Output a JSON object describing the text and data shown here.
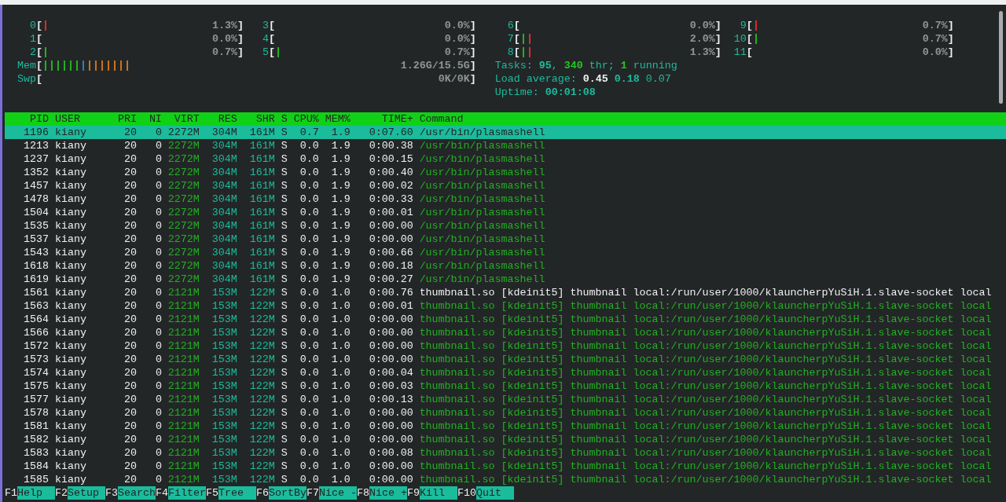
{
  "cpu_meters_left": [
    {
      "label": "0",
      "open": "[",
      "bars": [
        {
          "color": "#d32f2f"
        }
      ],
      "value": "1.3%",
      "close": "]"
    },
    {
      "label": "1",
      "open": "[",
      "value": "0.0%",
      "close": "]"
    },
    {
      "label": "2",
      "open": "[",
      "bars": [
        {
          "color": "#22b022"
        }
      ],
      "value": "0.7%",
      "close": "]"
    },
    {
      "label": "3",
      "open": "[",
      "value": "0.0%",
      "close": "]"
    },
    {
      "label": "4",
      "open": "[",
      "value": "0.0%",
      "close": "]"
    },
    {
      "label": "5",
      "open": "[",
      "bars": [
        {
          "color": "#22b022"
        }
      ],
      "value": "0.7%",
      "close": "]"
    }
  ],
  "cpu_meters_right": [
    {
      "label": "6",
      "open": "[",
      "value": "0.0%",
      "close": "]"
    },
    {
      "label": "7",
      "open": "[",
      "bars": [
        {
          "color": "#22b022"
        },
        {
          "color": "#d32f2f"
        }
      ],
      "value": "2.0%",
      "close": "]"
    },
    {
      "label": "8",
      "open": "[",
      "bars": [
        {
          "color": "#22b022"
        },
        {
          "color": "#d32f2f"
        }
      ],
      "value": "1.3%",
      "close": "]"
    },
    {
      "label": "9",
      "open": "[",
      "bars": [
        {
          "color": "#d32f2f"
        }
      ],
      "value": "0.7%",
      "close": "]"
    },
    {
      "label": "10",
      "open": "[",
      "bars": [
        {
          "color": "#22b022"
        }
      ],
      "value": "0.7%",
      "close": "]"
    },
    {
      "label": "11",
      "open": "[",
      "value": "0.0%",
      "close": "]"
    }
  ],
  "memory_meters": [
    {
      "label": "Mem",
      "open": "[",
      "bars": [
        {
          "color": "#22b022"
        },
        {
          "color": "#22b022"
        },
        {
          "color": "#22b022"
        },
        {
          "color": "#22b022"
        },
        {
          "color": "#22b022"
        },
        {
          "color": "#22b022"
        },
        {
          "color": "#2980b9"
        },
        {
          "color": "#c8741c"
        },
        {
          "color": "#c8741c"
        },
        {
          "color": "#c8741c"
        },
        {
          "color": "#c8741c"
        },
        {
          "color": "#c8741c"
        },
        {
          "color": "#c8741c"
        },
        {
          "color": "#c8741c"
        }
      ],
      "value": "1.26G/15.5G",
      "close": "]"
    },
    {
      "label": "Swp",
      "open": "[",
      "value": "0K/0K",
      "close": "]"
    }
  ],
  "summary_lines": [
    [
      {
        "text": "Tasks:",
        "kind": "label"
      },
      {
        "text": "95",
        "kind": "value"
      },
      {
        "text": ",",
        "kind": "punct"
      },
      {
        "text": "340",
        "kind": "highlight"
      },
      {
        "text": "thr;",
        "kind": "label"
      },
      {
        "text": "1",
        "kind": "highlight"
      },
      {
        "text": "running",
        "kind": "label"
      }
    ],
    [
      {
        "text": "Load average:",
        "kind": "label"
      },
      {
        "text": "0.45",
        "kind": "strong"
      },
      {
        "text": "0.18",
        "kind": "value"
      },
      {
        "text": "0.07",
        "kind": "label"
      }
    ],
    [
      {
        "text": "Uptime:",
        "kind": "label"
      },
      {
        "text": "00:01:08",
        "kind": "value"
      }
    ]
  ],
  "table": {
    "columns": [
      "PID",
      "USER",
      "PRI",
      "NI",
      "VIRT",
      "RES",
      "SHR",
      "S",
      "CPU%",
      "MEM%",
      "TIME+",
      "Command"
    ],
    "rows": [
      {
        "selected": true,
        "cells": [
          "1196",
          "kiany",
          "20",
          "0",
          "2272M",
          "304M",
          "161M",
          "S",
          "0.7",
          "1.9",
          "0:07.60",
          "/usr/bin/plasmashell"
        ]
      },
      {
        "selected": false,
        "kind": "thread",
        "cells": [
          "1213",
          "kiany",
          "20",
          "0",
          "2272M",
          "304M",
          "161M",
          "S",
          "0.0",
          "1.9",
          "0:00.38",
          "/usr/bin/plasmashell"
        ]
      },
      {
        "selected": false,
        "kind": "thread",
        "cells": [
          "1237",
          "kiany",
          "20",
          "0",
          "2272M",
          "304M",
          "161M",
          "S",
          "0.0",
          "1.9",
          "0:00.15",
          "/usr/bin/plasmashell"
        ]
      },
      {
        "selected": false,
        "kind": "thread",
        "cells": [
          "1352",
          "kiany",
          "20",
          "0",
          "2272M",
          "304M",
          "161M",
          "S",
          "0.0",
          "1.9",
          "0:00.40",
          "/usr/bin/plasmashell"
        ]
      },
      {
        "selected": false,
        "kind": "thread",
        "cells": [
          "1457",
          "kiany",
          "20",
          "0",
          "2272M",
          "304M",
          "161M",
          "S",
          "0.0",
          "1.9",
          "0:00.02",
          "/usr/bin/plasmashell"
        ]
      },
      {
        "selected": false,
        "kind": "thread",
        "cells": [
          "1478",
          "kiany",
          "20",
          "0",
          "2272M",
          "304M",
          "161M",
          "S",
          "0.0",
          "1.9",
          "0:00.33",
          "/usr/bin/plasmashell"
        ]
      },
      {
        "selected": false,
        "kind": "thread",
        "cells": [
          "1504",
          "kiany",
          "20",
          "0",
          "2272M",
          "304M",
          "161M",
          "S",
          "0.0",
          "1.9",
          "0:00.01",
          "/usr/bin/plasmashell"
        ]
      },
      {
        "selected": false,
        "kind": "thread",
        "cells": [
          "1535",
          "kiany",
          "20",
          "0",
          "2272M",
          "304M",
          "161M",
          "S",
          "0.0",
          "1.9",
          "0:00.00",
          "/usr/bin/plasmashell"
        ]
      },
      {
        "selected": false,
        "kind": "thread",
        "cells": [
          "1537",
          "kiany",
          "20",
          "0",
          "2272M",
          "304M",
          "161M",
          "S",
          "0.0",
          "1.9",
          "0:00.00",
          "/usr/bin/plasmashell"
        ]
      },
      {
        "selected": false,
        "kind": "thread",
        "cells": [
          "1543",
          "kiany",
          "20",
          "0",
          "2272M",
          "304M",
          "161M",
          "S",
          "0.0",
          "1.9",
          "0:00.66",
          "/usr/bin/plasmashell"
        ]
      },
      {
        "selected": false,
        "kind": "thread",
        "cells": [
          "1618",
          "kiany",
          "20",
          "0",
          "2272M",
          "304M",
          "161M",
          "S",
          "0.0",
          "1.9",
          "0:00.18",
          "/usr/bin/plasmashell"
        ]
      },
      {
        "selected": false,
        "kind": "thread",
        "cells": [
          "1619",
          "kiany",
          "20",
          "0",
          "2272M",
          "304M",
          "161M",
          "S",
          "0.0",
          "1.9",
          "0:00.27",
          "/usr/bin/plasmashell"
        ]
      },
      {
        "selected": false,
        "kind": "process",
        "cells": [
          "1561",
          "kiany",
          "20",
          "0",
          "2121M",
          "153M",
          "122M",
          "S",
          "0.0",
          "1.0",
          "0:00.76",
          "thumbnail.so [kdeinit5] thumbnail local:/run/user/1000/klauncherpYuSiH.1.slave-socket local"
        ]
      },
      {
        "selected": false,
        "kind": "thread",
        "cells": [
          "1563",
          "kiany",
          "20",
          "0",
          "2121M",
          "153M",
          "122M",
          "S",
          "0.0",
          "1.0",
          "0:00.01",
          "thumbnail.so [kdeinit5] thumbnail local:/run/user/1000/klauncherpYuSiH.1.slave-socket local"
        ]
      },
      {
        "selected": false,
        "kind": "thread",
        "cells": [
          "1564",
          "kiany",
          "20",
          "0",
          "2121M",
          "153M",
          "122M",
          "S",
          "0.0",
          "1.0",
          "0:00.00",
          "thumbnail.so [kdeinit5] thumbnail local:/run/user/1000/klauncherpYuSiH.1.slave-socket local"
        ]
      },
      {
        "selected": false,
        "kind": "thread",
        "cells": [
          "1566",
          "kiany",
          "20",
          "0",
          "2121M",
          "153M",
          "122M",
          "S",
          "0.0",
          "1.0",
          "0:00.00",
          "thumbnail.so [kdeinit5] thumbnail local:/run/user/1000/klauncherpYuSiH.1.slave-socket local"
        ]
      },
      {
        "selected": false,
        "kind": "thread",
        "cells": [
          "1572",
          "kiany",
          "20",
          "0",
          "2121M",
          "153M",
          "122M",
          "S",
          "0.0",
          "1.0",
          "0:00.00",
          "thumbnail.so [kdeinit5] thumbnail local:/run/user/1000/klauncherpYuSiH.1.slave-socket local"
        ]
      },
      {
        "selected": false,
        "kind": "thread",
        "cells": [
          "1573",
          "kiany",
          "20",
          "0",
          "2121M",
          "153M",
          "122M",
          "S",
          "0.0",
          "1.0",
          "0:00.00",
          "thumbnail.so [kdeinit5] thumbnail local:/run/user/1000/klauncherpYuSiH.1.slave-socket local"
        ]
      },
      {
        "selected": false,
        "kind": "thread",
        "cells": [
          "1574",
          "kiany",
          "20",
          "0",
          "2121M",
          "153M",
          "122M",
          "S",
          "0.0",
          "1.0",
          "0:00.04",
          "thumbnail.so [kdeinit5] thumbnail local:/run/user/1000/klauncherpYuSiH.1.slave-socket local"
        ]
      },
      {
        "selected": false,
        "kind": "thread",
        "cells": [
          "1575",
          "kiany",
          "20",
          "0",
          "2121M",
          "153M",
          "122M",
          "S",
          "0.0",
          "1.0",
          "0:00.03",
          "thumbnail.so [kdeinit5] thumbnail local:/run/user/1000/klauncherpYuSiH.1.slave-socket local"
        ]
      },
      {
        "selected": false,
        "kind": "thread",
        "cells": [
          "1577",
          "kiany",
          "20",
          "0",
          "2121M",
          "153M",
          "122M",
          "S",
          "0.0",
          "1.0",
          "0:00.13",
          "thumbnail.so [kdeinit5] thumbnail local:/run/user/1000/klauncherpYuSiH.1.slave-socket local"
        ]
      },
      {
        "selected": false,
        "kind": "thread",
        "cells": [
          "1578",
          "kiany",
          "20",
          "0",
          "2121M",
          "153M",
          "122M",
          "S",
          "0.0",
          "1.0",
          "0:00.00",
          "thumbnail.so [kdeinit5] thumbnail local:/run/user/1000/klauncherpYuSiH.1.slave-socket local"
        ]
      },
      {
        "selected": false,
        "kind": "thread",
        "cells": [
          "1581",
          "kiany",
          "20",
          "0",
          "2121M",
          "153M",
          "122M",
          "S",
          "0.0",
          "1.0",
          "0:00.00",
          "thumbnail.so [kdeinit5] thumbnail local:/run/user/1000/klauncherpYuSiH.1.slave-socket local"
        ]
      },
      {
        "selected": false,
        "kind": "thread",
        "cells": [
          "1582",
          "kiany",
          "20",
          "0",
          "2121M",
          "153M",
          "122M",
          "S",
          "0.0",
          "1.0",
          "0:00.00",
          "thumbnail.so [kdeinit5] thumbnail local:/run/user/1000/klauncherpYuSiH.1.slave-socket local"
        ]
      },
      {
        "selected": false,
        "kind": "thread",
        "cells": [
          "1583",
          "kiany",
          "20",
          "0",
          "2121M",
          "153M",
          "122M",
          "S",
          "0.0",
          "1.0",
          "0:00.08",
          "thumbnail.so [kdeinit5] thumbnail local:/run/user/1000/klauncherpYuSiH.1.slave-socket local"
        ]
      },
      {
        "selected": false,
        "kind": "thread",
        "cells": [
          "1584",
          "kiany",
          "20",
          "0",
          "2121M",
          "153M",
          "122M",
          "S",
          "0.0",
          "1.0",
          "0:00.00",
          "thumbnail.so [kdeinit5] thumbnail local:/run/user/1000/klauncherpYuSiH.1.slave-socket local"
        ]
      },
      {
        "selected": false,
        "kind": "thread",
        "cells": [
          "1585",
          "kiany",
          "20",
          "0",
          "2121M",
          "153M",
          "122M",
          "S",
          "0.0",
          "1.0",
          "0:00.00",
          "thumbnail.so [kdeinit5] thumbnail local:/run/user/1000/klauncherpYuSiH.1.slave-socket local"
        ]
      }
    ]
  },
  "function_keys": [
    {
      "key": "F1",
      "label": "Help"
    },
    {
      "key": "F2",
      "label": "Setup"
    },
    {
      "key": "F3",
      "label": "Search"
    },
    {
      "key": "F4",
      "label": "Filter"
    },
    {
      "key": "F5",
      "label": "Tree"
    },
    {
      "key": "F6",
      "label": "SortBy"
    },
    {
      "key": "F7",
      "label": "Nice -"
    },
    {
      "key": "F8",
      "label": "Nice +"
    },
    {
      "key": "F9",
      "label": "Kill"
    },
    {
      "key": "F10",
      "label": "Quit"
    }
  ]
}
